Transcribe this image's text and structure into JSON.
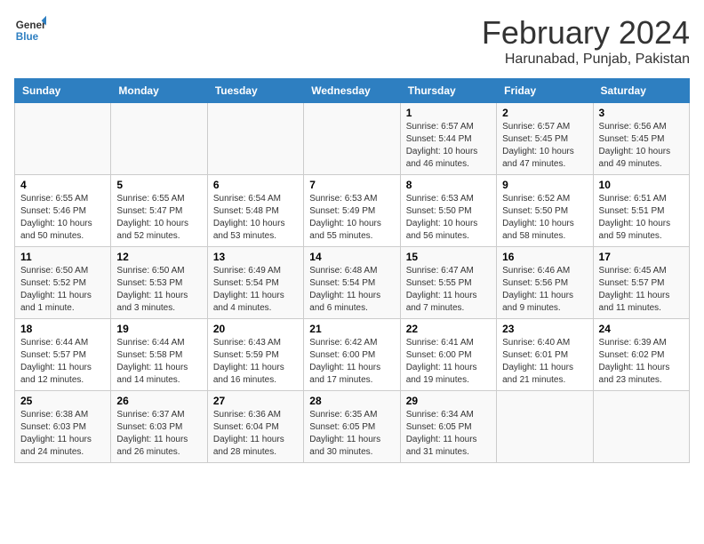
{
  "logo": {
    "line1": "General",
    "line2": "Blue"
  },
  "title": "February 2024",
  "subtitle": "Harunabad, Punjab, Pakistan",
  "days_of_week": [
    "Sunday",
    "Monday",
    "Tuesday",
    "Wednesday",
    "Thursday",
    "Friday",
    "Saturday"
  ],
  "weeks": [
    [
      {
        "day": "",
        "info": ""
      },
      {
        "day": "",
        "info": ""
      },
      {
        "day": "",
        "info": ""
      },
      {
        "day": "",
        "info": ""
      },
      {
        "day": "1",
        "info": "Sunrise: 6:57 AM\nSunset: 5:44 PM\nDaylight: 10 hours\nand 46 minutes."
      },
      {
        "day": "2",
        "info": "Sunrise: 6:57 AM\nSunset: 5:45 PM\nDaylight: 10 hours\nand 47 minutes."
      },
      {
        "day": "3",
        "info": "Sunrise: 6:56 AM\nSunset: 5:45 PM\nDaylight: 10 hours\nand 49 minutes."
      }
    ],
    [
      {
        "day": "4",
        "info": "Sunrise: 6:55 AM\nSunset: 5:46 PM\nDaylight: 10 hours\nand 50 minutes."
      },
      {
        "day": "5",
        "info": "Sunrise: 6:55 AM\nSunset: 5:47 PM\nDaylight: 10 hours\nand 52 minutes."
      },
      {
        "day": "6",
        "info": "Sunrise: 6:54 AM\nSunset: 5:48 PM\nDaylight: 10 hours\nand 53 minutes."
      },
      {
        "day": "7",
        "info": "Sunrise: 6:53 AM\nSunset: 5:49 PM\nDaylight: 10 hours\nand 55 minutes."
      },
      {
        "day": "8",
        "info": "Sunrise: 6:53 AM\nSunset: 5:50 PM\nDaylight: 10 hours\nand 56 minutes."
      },
      {
        "day": "9",
        "info": "Sunrise: 6:52 AM\nSunset: 5:50 PM\nDaylight: 10 hours\nand 58 minutes."
      },
      {
        "day": "10",
        "info": "Sunrise: 6:51 AM\nSunset: 5:51 PM\nDaylight: 10 hours\nand 59 minutes."
      }
    ],
    [
      {
        "day": "11",
        "info": "Sunrise: 6:50 AM\nSunset: 5:52 PM\nDaylight: 11 hours\nand 1 minute."
      },
      {
        "day": "12",
        "info": "Sunrise: 6:50 AM\nSunset: 5:53 PM\nDaylight: 11 hours\nand 3 minutes."
      },
      {
        "day": "13",
        "info": "Sunrise: 6:49 AM\nSunset: 5:54 PM\nDaylight: 11 hours\nand 4 minutes."
      },
      {
        "day": "14",
        "info": "Sunrise: 6:48 AM\nSunset: 5:54 PM\nDaylight: 11 hours\nand 6 minutes."
      },
      {
        "day": "15",
        "info": "Sunrise: 6:47 AM\nSunset: 5:55 PM\nDaylight: 11 hours\nand 7 minutes."
      },
      {
        "day": "16",
        "info": "Sunrise: 6:46 AM\nSunset: 5:56 PM\nDaylight: 11 hours\nand 9 minutes."
      },
      {
        "day": "17",
        "info": "Sunrise: 6:45 AM\nSunset: 5:57 PM\nDaylight: 11 hours\nand 11 minutes."
      }
    ],
    [
      {
        "day": "18",
        "info": "Sunrise: 6:44 AM\nSunset: 5:57 PM\nDaylight: 11 hours\nand 12 minutes."
      },
      {
        "day": "19",
        "info": "Sunrise: 6:44 AM\nSunset: 5:58 PM\nDaylight: 11 hours\nand 14 minutes."
      },
      {
        "day": "20",
        "info": "Sunrise: 6:43 AM\nSunset: 5:59 PM\nDaylight: 11 hours\nand 16 minutes."
      },
      {
        "day": "21",
        "info": "Sunrise: 6:42 AM\nSunset: 6:00 PM\nDaylight: 11 hours\nand 17 minutes."
      },
      {
        "day": "22",
        "info": "Sunrise: 6:41 AM\nSunset: 6:00 PM\nDaylight: 11 hours\nand 19 minutes."
      },
      {
        "day": "23",
        "info": "Sunrise: 6:40 AM\nSunset: 6:01 PM\nDaylight: 11 hours\nand 21 minutes."
      },
      {
        "day": "24",
        "info": "Sunrise: 6:39 AM\nSunset: 6:02 PM\nDaylight: 11 hours\nand 23 minutes."
      }
    ],
    [
      {
        "day": "25",
        "info": "Sunrise: 6:38 AM\nSunset: 6:03 PM\nDaylight: 11 hours\nand 24 minutes."
      },
      {
        "day": "26",
        "info": "Sunrise: 6:37 AM\nSunset: 6:03 PM\nDaylight: 11 hours\nand 26 minutes."
      },
      {
        "day": "27",
        "info": "Sunrise: 6:36 AM\nSunset: 6:04 PM\nDaylight: 11 hours\nand 28 minutes."
      },
      {
        "day": "28",
        "info": "Sunrise: 6:35 AM\nSunset: 6:05 PM\nDaylight: 11 hours\nand 30 minutes."
      },
      {
        "day": "29",
        "info": "Sunrise: 6:34 AM\nSunset: 6:05 PM\nDaylight: 11 hours\nand 31 minutes."
      },
      {
        "day": "",
        "info": ""
      },
      {
        "day": "",
        "info": ""
      }
    ]
  ]
}
